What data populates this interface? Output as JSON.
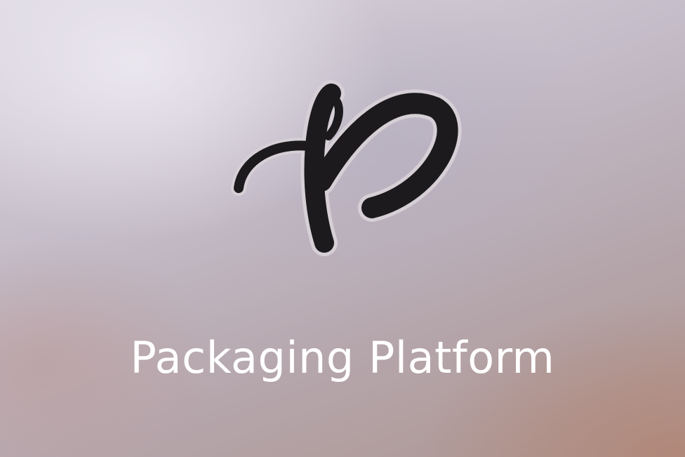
{
  "brand": {
    "logo_icon": "script-letter-p-logo-icon",
    "title": "Packaging Platform"
  },
  "colors": {
    "logo_fill": "#1c1a1c",
    "logo_outline": "#d6d0d6",
    "title_text": "#ffffff"
  }
}
